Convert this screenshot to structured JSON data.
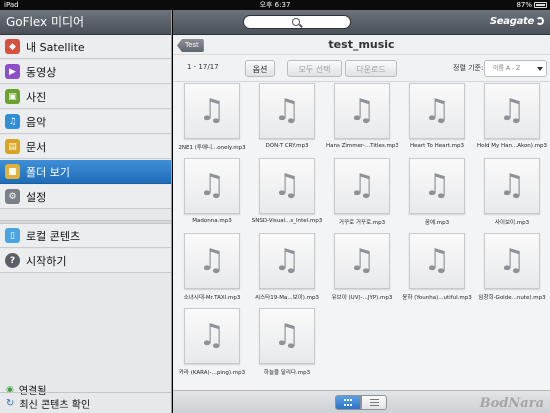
{
  "status": {
    "carrier": "iPad",
    "time": "오후 6:37",
    "battery": "87%"
  },
  "sidebar": {
    "title": "GoFlex 미디어",
    "items": [
      {
        "label": "내 Satellite",
        "icon": "satellite-icon",
        "color": "#d6523e"
      },
      {
        "label": "동영상",
        "icon": "video-icon",
        "color": "#8a4fc9"
      },
      {
        "label": "사진",
        "icon": "photo-icon",
        "color": "#6aa32c"
      },
      {
        "label": "음악",
        "icon": "music-icon",
        "color": "#2f8ed8"
      },
      {
        "label": "문서",
        "icon": "document-icon",
        "color": "#d9a421"
      },
      {
        "label": "폴더 보기",
        "icon": "folder-icon",
        "color": "#e0b23a"
      },
      {
        "label": "설정",
        "icon": "gear-icon",
        "color": "#7b8088"
      },
      {
        "label": "로컬 콘텐츠",
        "icon": "device-icon",
        "color": "#4aa4e0"
      },
      {
        "label": "시작하기",
        "icon": "help-icon",
        "color": "#5a5f66"
      }
    ],
    "connection": "연결됨",
    "refresh": "최신 콘텐츠 확인"
  },
  "header": {
    "logo": "Seagate"
  },
  "titlebar": {
    "back_label": "Test",
    "title": "test_music"
  },
  "toolbar": {
    "range": "1 - 17/17",
    "options": "옵션",
    "select_all": "모두 선택",
    "download": "다운로드",
    "sort_label": "정렬 기준:",
    "sort_value": "이름 A - Z"
  },
  "files": [
    "2NE1 (투애니...onely.mp3",
    "DON-T CRY.mp3",
    "Hans Zimmer-...Titles.mp3",
    "Heart To Heart.mp3",
    "Hold My Han...Akon).mp3",
    "Madonna.mp3",
    "SNSD-Visual...s_Intel.mp3",
    "거꾸로 거꾸로.mp3",
    "꿈에.mp3",
    "사이보이.mp3",
    "소녀시대-Mr.TAXI.mp3",
    "씨스타19-Ma...보이).mp3",
    "유브이 (UV)-...JYP).mp3",
    "윤하 (Younha)...utiful.mp3",
    "임창희-Golde...nute).mp3",
    "카라 (KARA)-...ping).mp3",
    "하늘을 달리다.mp3"
  ],
  "watermark": "BodNara"
}
